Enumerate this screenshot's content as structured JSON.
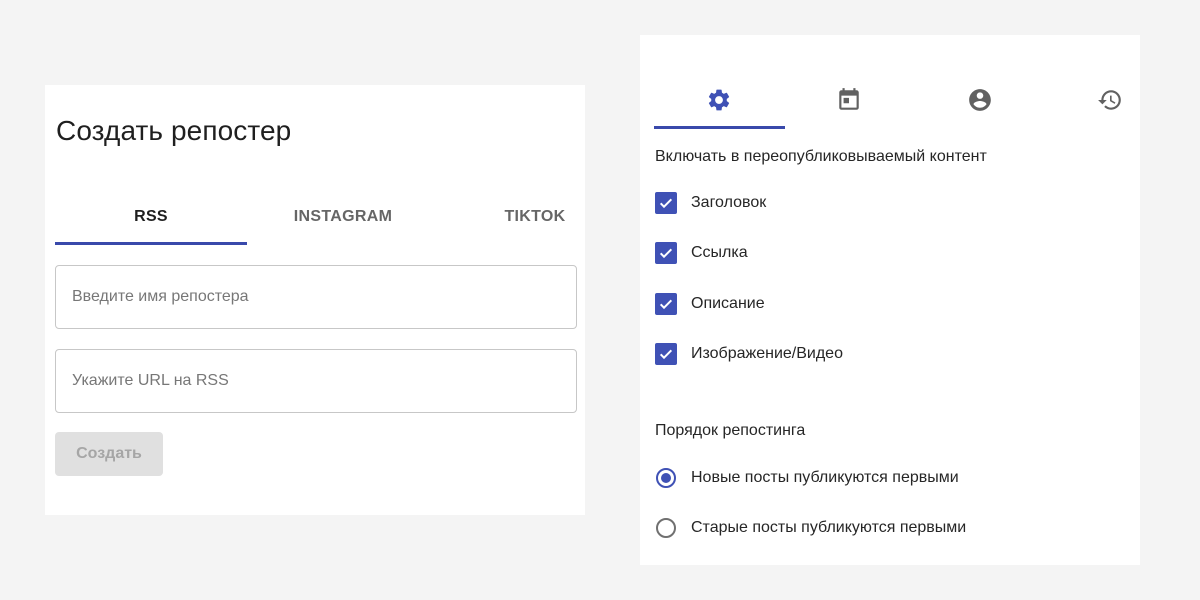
{
  "left_panel": {
    "title": "Создать репостер",
    "tabs": [
      {
        "label": "RSS",
        "active": true
      },
      {
        "label": "INSTAGRAM",
        "active": false
      },
      {
        "label": "TIKTOK",
        "active": false
      }
    ],
    "name_input": {
      "placeholder": "Введите имя репостера",
      "value": ""
    },
    "url_input": {
      "placeholder": "Укажите URL на RSS",
      "value": ""
    },
    "create_button": {
      "label": "Создать",
      "disabled": true
    }
  },
  "right_panel": {
    "tabs": [
      {
        "icon": "gear-icon",
        "active": true
      },
      {
        "icon": "calendar-icon",
        "active": false
      },
      {
        "icon": "account-circle-icon",
        "active": false
      },
      {
        "icon": "history-icon",
        "active": false
      }
    ],
    "include_label": "Включать в переопубликовываемый контент",
    "include_options": [
      {
        "label": "Заголовок",
        "checked": true
      },
      {
        "label": "Ссылка",
        "checked": true
      },
      {
        "label": "Описание",
        "checked": true
      },
      {
        "label": "Изображение/Видео",
        "checked": true
      }
    ],
    "order_label": "Порядок репостинга",
    "order_options": [
      {
        "label": "Новые посты публикуются первыми",
        "selected": true
      },
      {
        "label": "Старые посты публикуются первыми",
        "selected": false
      }
    ]
  },
  "colors": {
    "accent": "#3f51b5",
    "background": "#f4f4f4",
    "card": "#ffffff",
    "disabled_button_bg": "#e0e0e0",
    "disabled_button_text": "#a6a6a6"
  }
}
